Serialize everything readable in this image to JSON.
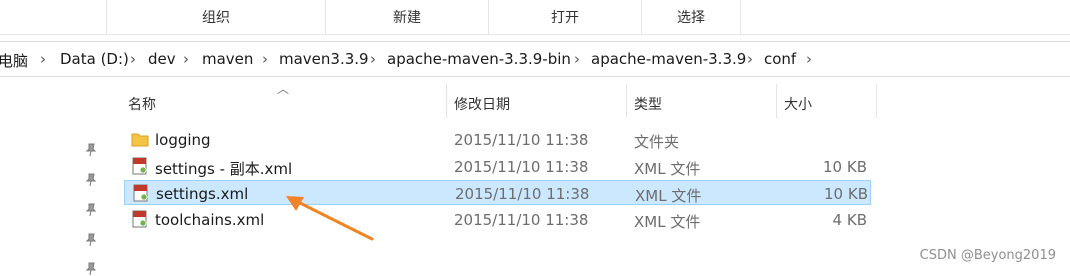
{
  "ribbon": {
    "tabs": [
      "组织",
      "新建",
      "打开",
      "选择"
    ]
  },
  "breadcrumbs": [
    "电脑",
    "Data (D:)",
    "dev",
    "maven",
    "maven3.3.9",
    "apache-maven-3.3.9-bin",
    "apache-maven-3.3.9",
    "conf"
  ],
  "columns": {
    "name": "名称",
    "date": "修改日期",
    "type": "类型",
    "size": "大小"
  },
  "files": [
    {
      "name": "logging",
      "date": "2015/11/10 11:38",
      "type": "文件夹",
      "size": "",
      "icon": "folder-icon",
      "selected": false
    },
    {
      "name": "settings - 副本.xml",
      "date": "2015/11/10 11:38",
      "type": "XML 文件",
      "size": "10 KB",
      "icon": "xml-file-icon",
      "selected": false
    },
    {
      "name": "settings.xml",
      "date": "2015/11/10 11:38",
      "type": "XML 文件",
      "size": "10 KB",
      "icon": "xml-file-icon",
      "selected": true
    },
    {
      "name": "toolchains.xml",
      "date": "2015/11/10 11:38",
      "type": "XML 文件",
      "size": "4 KB",
      "icon": "xml-file-icon",
      "selected": false
    }
  ],
  "watermark": "CSDN @Beyong2019",
  "colors": {
    "selection": "#cce8ff",
    "selection_border": "#99d1ff",
    "arrow": "#f08228"
  }
}
